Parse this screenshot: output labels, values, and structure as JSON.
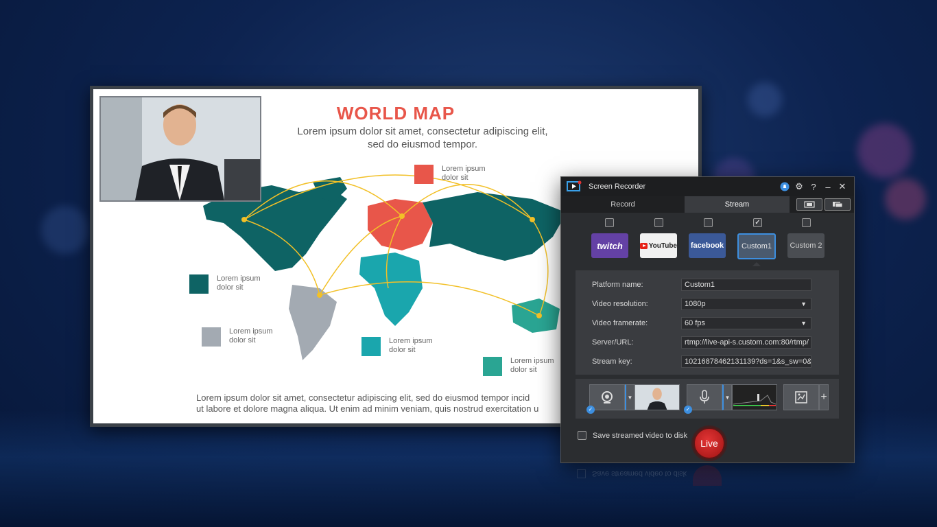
{
  "slide": {
    "title": "WORLD MAP",
    "subtitle_line1": "Lorem ipsum dolor sit amet, consectetur adipiscing elit,",
    "subtitle_line2": "sed do eiusmod tempor.",
    "legend": [
      {
        "text": "Lorem ipsum dolor sit",
        "color": "#e8564a"
      },
      {
        "text": "Lorem ipsum dolor sit",
        "color": "#0e6364"
      },
      {
        "text": "Lorem ipsum dolor sit",
        "color": "#a3aab2"
      },
      {
        "text": "Lorem ipsum dolor sit",
        "color": "#1aa6ad"
      },
      {
        "text": "Lorem ipsum dolor sit",
        "color": "#2aa593"
      }
    ],
    "footer_line1": "Lorem ipsum dolor sit amet, consectetur adipiscing elit, sed do eiusmod tempor incid",
    "footer_line2": "ut labore et dolore magna aliqua. Ut enim ad minim veniam, quis nostrud exercitation u"
  },
  "app": {
    "title": "Screen Recorder",
    "tabs": [
      {
        "label": "Record"
      },
      {
        "label": "Stream"
      }
    ],
    "platforms": [
      {
        "label": "twitch",
        "checked": false
      },
      {
        "label": "YouTube",
        "checked": false
      },
      {
        "label": "facebook",
        "checked": false
      },
      {
        "label": "Custom1",
        "checked": true
      },
      {
        "label": "Custom 2",
        "checked": false
      }
    ],
    "settings": {
      "platform_name_label": "Platform name:",
      "platform_name_value": "Custom1",
      "resolution_label": "Video resolution:",
      "resolution_value": "1080p",
      "framerate_label": "Video framerate:",
      "framerate_value": "60 fps",
      "server_label": "Server/URL:",
      "server_value": "rtmp://live-api-s.custom.com:80/rtmp/",
      "key_label": "Stream key:",
      "key_value": "10216878462131139?ds=1&s_sw=0&"
    },
    "save_label": "Save streamed video to disk",
    "live_label": "Live",
    "add_symbol": "+"
  },
  "colors": {
    "accent": "#3d8fe0",
    "live_red": "#c81e1e",
    "twitch": "#6441a5",
    "facebook": "#3b5998"
  }
}
